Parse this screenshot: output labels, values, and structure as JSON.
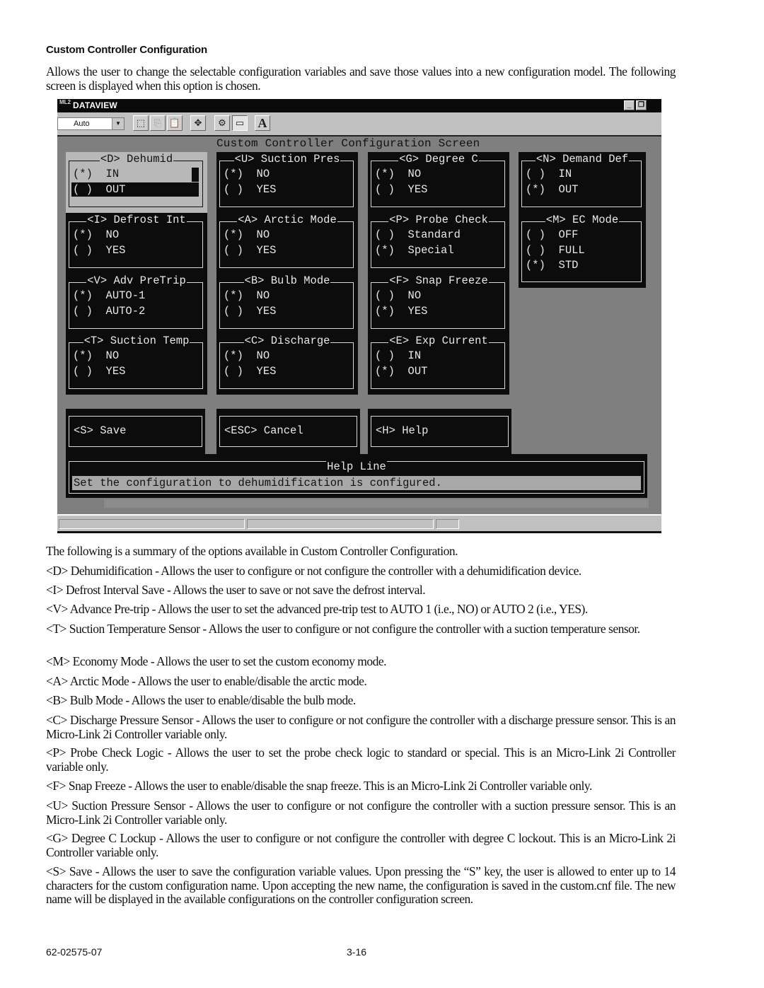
{
  "heading": "Custom Controller Configuration",
  "intro": "Allows the user to change the selectable configuration variables and save those values into a new configuration model. The following screen is displayed when this option is chosen.",
  "window": {
    "app_icon": "ML2",
    "title": "DATAVIEW",
    "controls": {
      "minimize": "_",
      "restore": "❐"
    },
    "toolbar": {
      "font_size_value": "Auto",
      "buttons": [
        {
          "name": "select-icon",
          "glyph": "⬚"
        },
        {
          "name": "copy-icon",
          "glyph": "⎘"
        },
        {
          "name": "paste-icon",
          "glyph": "📋"
        },
        {
          "name": "fullscreen-icon",
          "glyph": "✥"
        },
        {
          "name": "properties-icon",
          "glyph": "⚙"
        },
        {
          "name": "background-icon",
          "glyph": "▭"
        },
        {
          "name": "font-icon",
          "glyph": "A"
        }
      ]
    },
    "screen": {
      "title": "Custom Controller Configuration Screen",
      "panels": [
        {
          "key": "D",
          "title": "<D> Dehumid",
          "options": [
            {
              "mark": "(*)",
              "label": "IN"
            },
            {
              "mark": "( )",
              "label": "OUT"
            }
          ],
          "selected": "IN",
          "active": true
        },
        {
          "key": "U",
          "title": "<U> Suction Pres",
          "options": [
            {
              "mark": "(*)",
              "label": "NO"
            },
            {
              "mark": "( )",
              "label": "YES"
            }
          ],
          "selected": "NO"
        },
        {
          "key": "G",
          "title": "<G> Degree C",
          "options": [
            {
              "mark": "(*)",
              "label": "NO"
            },
            {
              "mark": "( )",
              "label": "YES"
            }
          ],
          "selected": "NO"
        },
        {
          "key": "N",
          "title": "<N> Demand Def",
          "options": [
            {
              "mark": "( )",
              "label": "IN"
            },
            {
              "mark": "(*)",
              "label": "OUT"
            }
          ],
          "selected": "OUT"
        },
        {
          "key": "I",
          "title": "<I> Defrost Int",
          "options": [
            {
              "mark": "(*)",
              "label": "NO"
            },
            {
              "mark": "( )",
              "label": "YES"
            }
          ],
          "selected": "NO"
        },
        {
          "key": "A",
          "title": "<A> Arctic Mode",
          "options": [
            {
              "mark": "(*)",
              "label": "NO"
            },
            {
              "mark": "( )",
              "label": "YES"
            }
          ],
          "selected": "NO"
        },
        {
          "key": "P",
          "title": "<P> Probe Check",
          "options": [
            {
              "mark": "( )",
              "label": "Standard"
            },
            {
              "mark": "(*)",
              "label": "Special"
            }
          ],
          "selected": "Special"
        },
        {
          "key": "M",
          "title": "<M> EC Mode",
          "options": [
            {
              "mark": "( )",
              "label": "OFF"
            },
            {
              "mark": "( )",
              "label": "FULL"
            },
            {
              "mark": "(*)",
              "label": "STD"
            }
          ],
          "selected": "STD"
        },
        {
          "key": "V",
          "title": "<V> Adv PreTrip",
          "options": [
            {
              "mark": "(*)",
              "label": "AUTO-1"
            },
            {
              "mark": "( )",
              "label": "AUTO-2"
            }
          ],
          "selected": "AUTO-1"
        },
        {
          "key": "B",
          "title": "<B> Bulb Mode",
          "options": [
            {
              "mark": "(*)",
              "label": "NO"
            },
            {
              "mark": "( )",
              "label": "YES"
            }
          ],
          "selected": "NO"
        },
        {
          "key": "F",
          "title": "<F> Snap Freeze",
          "options": [
            {
              "mark": "( )",
              "label": "NO"
            },
            {
              "mark": "(*)",
              "label": "YES"
            }
          ],
          "selected": "YES"
        },
        {
          "key": "T",
          "title": "<T> Suction Temp",
          "options": [
            {
              "mark": "(*)",
              "label": "NO"
            },
            {
              "mark": "( )",
              "label": "YES"
            }
          ],
          "selected": "NO"
        },
        {
          "key": "C",
          "title": "<C> Discharge",
          "options": [
            {
              "mark": "(*)",
              "label": "NO"
            },
            {
              "mark": "( )",
              "label": "YES"
            }
          ],
          "selected": "NO"
        },
        {
          "key": "E",
          "title": "<E> Exp Current",
          "options": [
            {
              "mark": "( )",
              "label": "IN"
            },
            {
              "mark": "(*)",
              "label": "OUT"
            }
          ],
          "selected": "OUT"
        }
      ],
      "buttons": {
        "save": "<S> Save",
        "cancel": "<ESC> Cancel",
        "help": "<H> Help"
      },
      "help_line": {
        "title": "Help Line",
        "text": "Set the configuration to dehumidification is configured."
      }
    }
  },
  "summary": [
    "The following is a summary of the options available in Custom Controller Configuration.",
    "<D> Dehumidification - Allows the user to configure or not configure the controller with a dehumidification device.",
    "<I> Defrost Interval Save - Allows the user to save or not save the defrost interval.",
    "<V> Advance Pre-trip - Allows the user to set the advanced pre-trip test to AUTO 1 (i.e., NO) or AUTO 2 (i.e., YES).",
    "<T> Suction Temperature Sensor - Allows the user to configure or not configure the controller with a suction temperature sensor.",
    "<M> Economy Mode - Allows the user to set the custom economy mode.",
    "<A> Arctic Mode - Allows the user to enable/disable the arctic mode.",
    "<B> Bulb Mode - Allows the user to enable/disable the bulb mode.",
    "<C> Discharge Pressure Sensor - Allows the user to configure or not configure the controller with a discharge pressure sensor. This is an Micro-Link 2i Controller variable only.",
    "<P> Probe Check Logic - Allows the user to set the probe check logic to standard or special. This is an Micro-Link 2i Controller variable only.",
    "<F> Snap Freeze - Allows the user to enable/disable the snap freeze. This is an Micro-Link 2i Controller variable only.",
    "<U> Suction Pressure Sensor - Allows the user to configure or not configure the controller with a suction pressure sensor. This is an Micro-Link 2i Controller variable only.",
    "<G> Degree C Lockup - Allows the user to configure or not configure the controller with degree C lockout. This is an Micro-Link 2i Controller variable only.",
    "<S> Save - Allows the user to save the configuration variable values. Upon pressing the “S” key, the user is allowed to enter up to 14 characters for the custom configuration name. Upon accepting the new name, the configuration is saved in the custom.cnf file. The new name will be displayed in the available configurations on the controller configuration screen."
  ],
  "footer": {
    "doc_number": "62-02575-07",
    "page": "3-16"
  }
}
